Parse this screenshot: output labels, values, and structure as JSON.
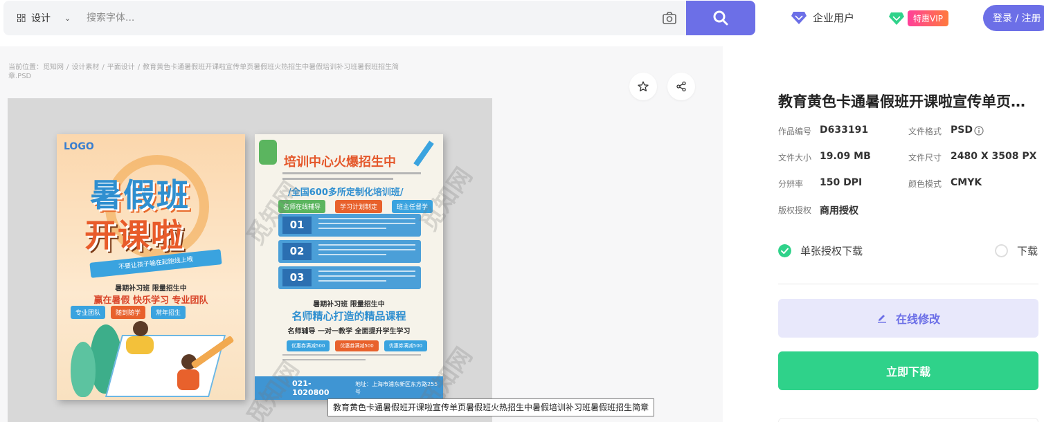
{
  "header": {
    "category_label": "设计",
    "search_placeholder": "搜索字体...",
    "enterprise_label": "企业用户",
    "vip_badge": "特惠VIP",
    "login_label": "登录 / 注册"
  },
  "breadcrumb": {
    "prefix": "当前位置：",
    "items": [
      "觅知网",
      "设计素材",
      "平面设计"
    ],
    "current": "教育黄色卡通暑假班开课啦宣传单页暑假班火热招生中暑假培训补习班暑假班招生简章.PSD"
  },
  "preview": {
    "tooltip": "教育黄色卡通暑假班开课啦宣传单页暑假班火热招生中暑假培训补习班暑假班招生简章",
    "watermark": "觅知网",
    "poster1": {
      "logo": "LOGO",
      "headline1": "暑假班",
      "headline2": "开课啦",
      "ribbon": "不要让孩子输在起跑线上哦",
      "line1": "暑期补习班 限量招生中",
      "line2": "赢在暑假 快乐学习 专业团队",
      "tags": [
        "专业团队",
        "随到随学",
        "常年招生"
      ]
    },
    "poster2": {
      "title": "培训中心火爆招生中",
      "headline": "/全国600多所定制化培训班/",
      "tags": [
        "名师在线辅导",
        "学习计划制定",
        "班主任督学"
      ],
      "rows": [
        "01",
        "02",
        "03"
      ],
      "line1": "暑期补习班 限量招生中",
      "line2": "名师精心打造的精品课程",
      "line3": "名师辅导  一对一教学  全面提升学生学习",
      "coupons": [
        "优惠券满减500",
        "优惠券满减500",
        "优惠券满减500"
      ],
      "phone": "021-1020800",
      "address": "地址：上海市浦东新区东方路255号"
    }
  },
  "detail": {
    "title": "教育黄色卡通暑假班开课啦宣传单页暑假班火热招生中暑假培训补习班暑假班招生简章",
    "fields": [
      {
        "label": "作品编号",
        "value": "D633191"
      },
      {
        "label": "文件格式",
        "value": "PSD"
      },
      {
        "label": "文件大小",
        "value": "19.09 MB"
      },
      {
        "label": "文件尺寸",
        "value": "2480 X 3508 PX"
      },
      {
        "label": "分辨率",
        "value": "150 DPI"
      },
      {
        "label": "颜色模式",
        "value": "CMYK"
      },
      {
        "label": "版权授权",
        "value": "商用授权"
      }
    ],
    "license_single": "单张授权下载",
    "license_other": "下载",
    "edit_online": "在线修改",
    "download_now": "立即下载"
  },
  "colors": {
    "accent": "#6c6fe7",
    "green": "#2fd28a",
    "enterprise_icon": "#6c6fe7",
    "vip_icon": "#2fd28a"
  }
}
